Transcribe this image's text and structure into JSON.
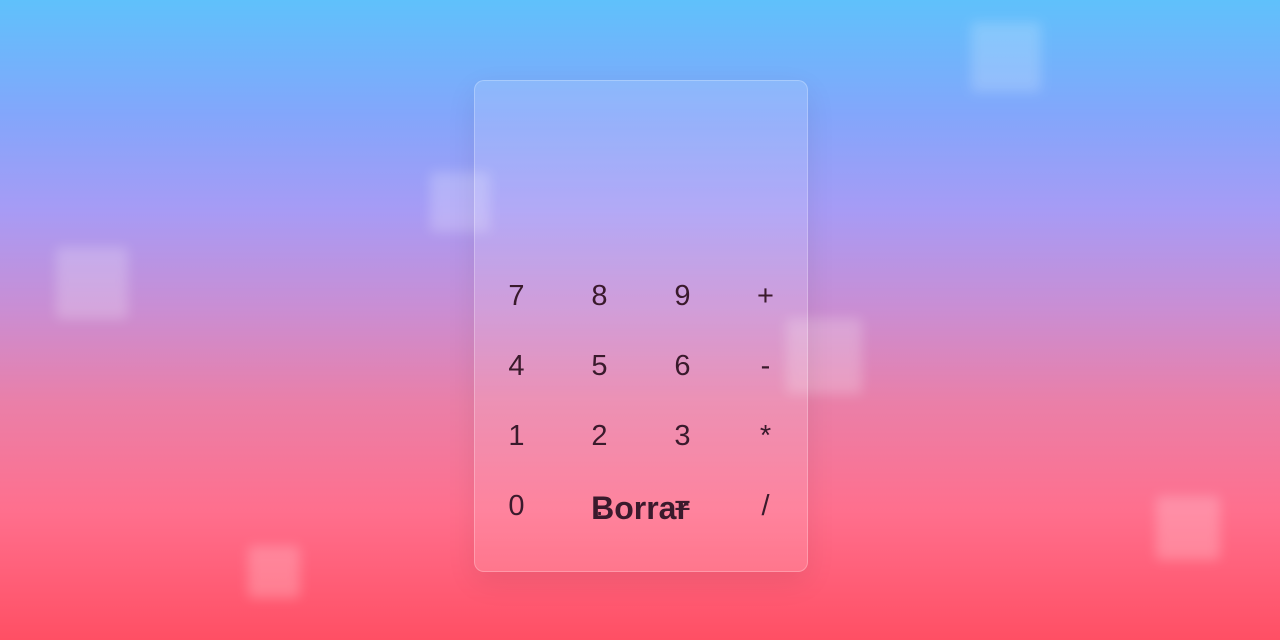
{
  "keypad": {
    "rows": [
      [
        "7",
        "8",
        "9",
        "+"
      ],
      [
        "4",
        "5",
        "6",
        "-"
      ],
      [
        "1",
        "2",
        "3",
        "*"
      ],
      [
        "0",
        ".",
        "=",
        "/"
      ]
    ]
  },
  "clear_label": "Borrar",
  "colors": {
    "gradient_top": "#5fc1fb",
    "gradient_mid": "#a79bf5",
    "gradient_bottom": "#ff4f64",
    "key_text": "#3a1a2c"
  }
}
